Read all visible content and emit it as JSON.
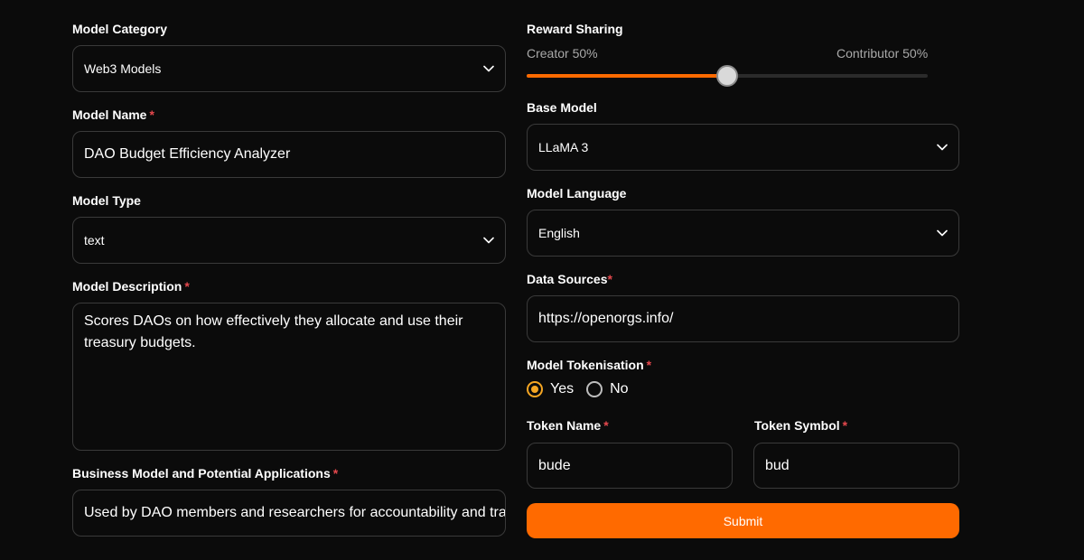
{
  "left": {
    "model_category": {
      "label": "Model Category",
      "value": "Web3 Models"
    },
    "model_name": {
      "label": "Model Name",
      "required": "*",
      "value": "DAO Budget Efficiency Analyzer"
    },
    "model_type": {
      "label": "Model Type",
      "value": "text"
    },
    "model_description": {
      "label": "Model Description",
      "required": "*",
      "value": "Scores DAOs on how effectively they allocate and use their treasury budgets."
    },
    "business_model": {
      "label": "Business Model and Potential Applications",
      "required": "*",
      "value": "Used by DAO members and researchers for accountability and transparency"
    }
  },
  "right": {
    "reward_sharing": {
      "label": "Reward Sharing",
      "creator_label": "Creator 50%",
      "contributor_label": "Contributor 50%",
      "creator_percent": 50
    },
    "base_model": {
      "label": "Base Model",
      "value": "LLaMA 3"
    },
    "model_language": {
      "label": "Model Language",
      "value": "English"
    },
    "data_sources": {
      "label": "Data Sources",
      "required": "*",
      "value": "https://openorgs.info/"
    },
    "model_tokenisation": {
      "label": "Model Tokenisation",
      "required": "*",
      "options": [
        "Yes",
        "No"
      ],
      "selected": "Yes"
    },
    "token_name": {
      "label": "Token Name",
      "required": "*",
      "value": "bude"
    },
    "token_symbol": {
      "label": "Token Symbol",
      "required": "*",
      "value": "bud"
    },
    "submit_label": "Submit"
  },
  "colors": {
    "background": "#0b0b0b",
    "accent": "#ff6a00",
    "radio_selected": "#f5a623",
    "required": "#e5484d",
    "border": "#3a3a3a"
  },
  "icons": {
    "select_chevron": "chevron-down-icon"
  }
}
